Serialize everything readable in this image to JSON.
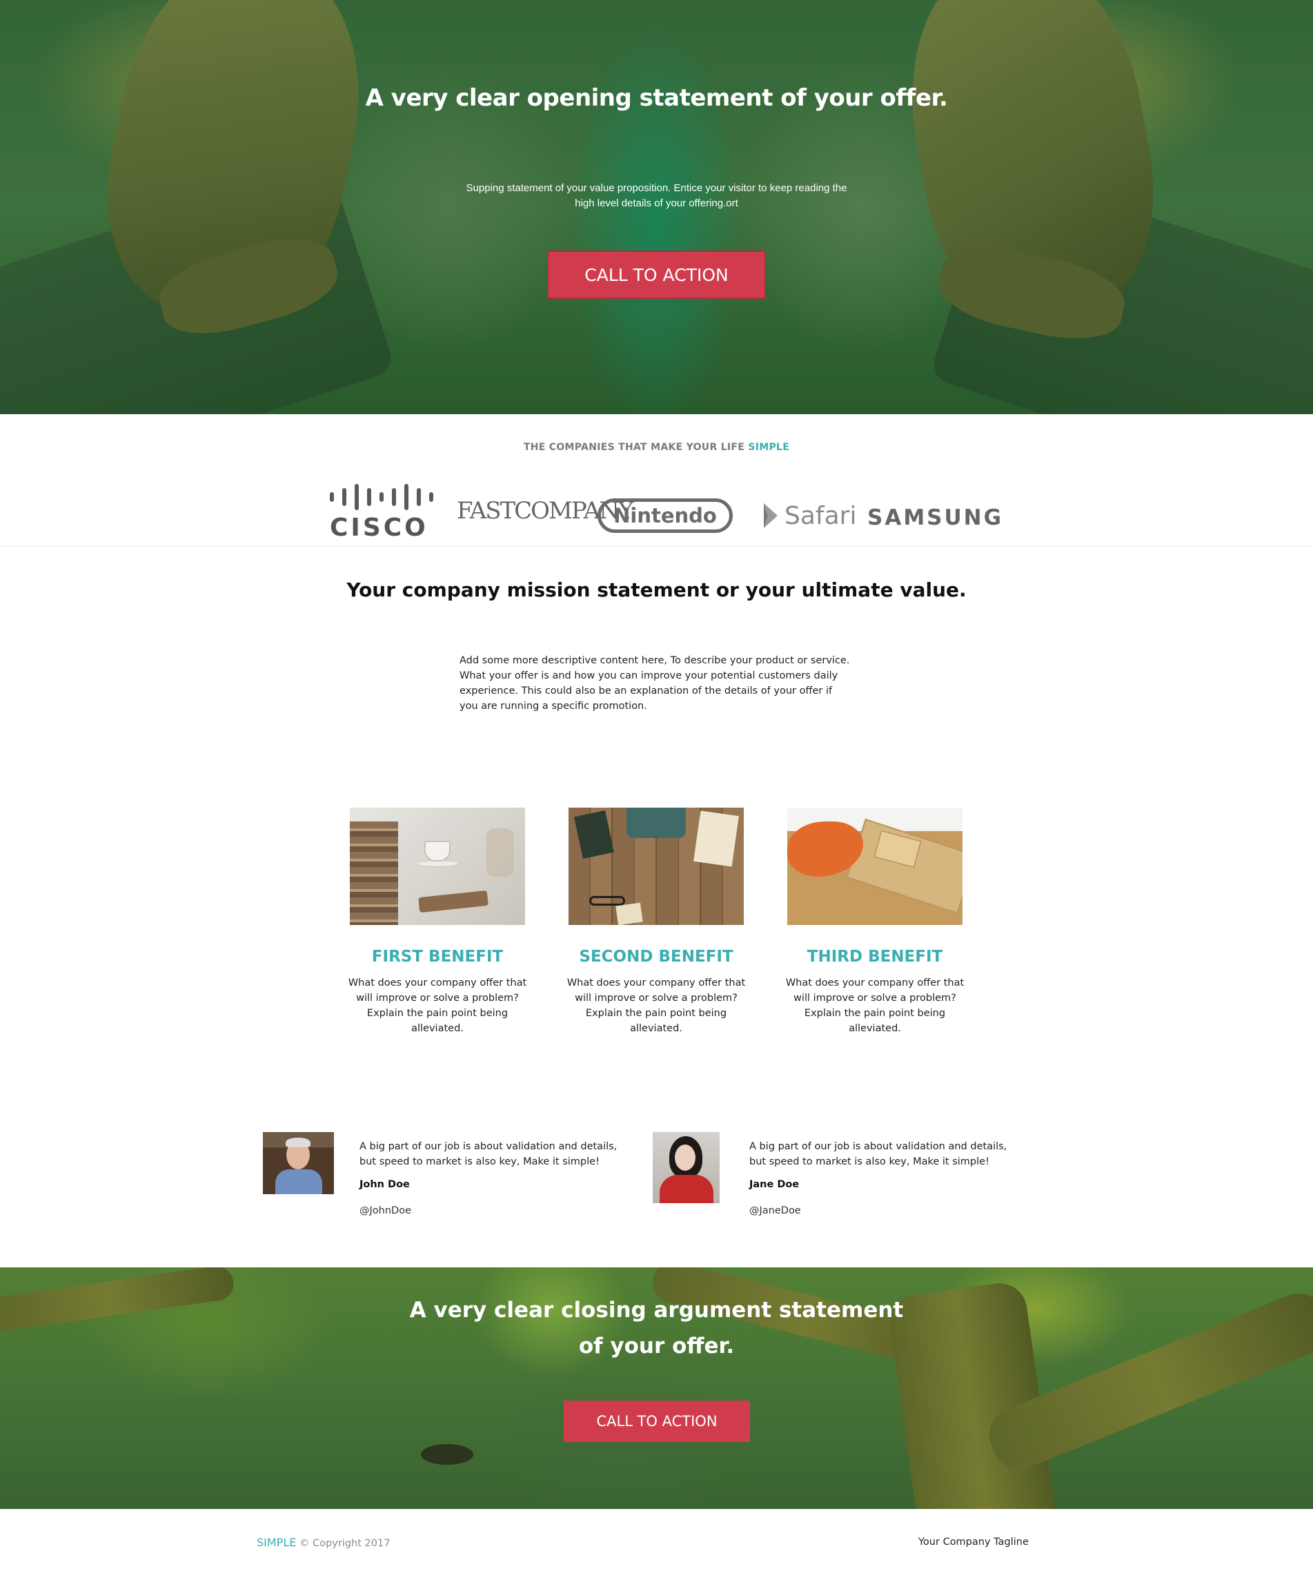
{
  "hero": {
    "title": "A very clear opening statement of your offer.",
    "subtitle": "Supping statement of your value proposition. Entice your visitor to keep reading the high level details of your offering.ort",
    "cta_label": "CALL TO ACTION"
  },
  "companies": {
    "heading_prefix": "THE COMPANIES THAT MAKE YOUR LIFE ",
    "heading_accent": "SIMPLE",
    "logos": {
      "cisco": "CISCO",
      "fast_company": "FASTCOMPANY",
      "nintendo": "Nintendo",
      "safari": "Safari",
      "samsung": "SAMSUNG"
    }
  },
  "mission": {
    "title": "Your company mission statement or your ultimate value.",
    "body": "Add some more descriptive content here, To describe your product or service. What your offer is and how you can improve your potential customers daily experience. This could also be an explanation of the details of your offer if you are running a specific promotion."
  },
  "benefits": [
    {
      "title": "FIRST BENEFIT",
      "text": "What does your company offer that will improve or solve a problem? Explain the pain point being alleviated."
    },
    {
      "title": "SECOND BENEFIT",
      "text": "What does your company offer that will improve or solve a problem? Explain the pain point being alleviated."
    },
    {
      "title": "THIRD BENEFIT",
      "text": "What does your company offer that will improve or solve a problem? Explain the pain point being alleviated."
    }
  ],
  "testimonials": [
    {
      "quote": "A big part of our job is about validation and details, but speed to market is also key, Make it simple!",
      "name": "John Doe",
      "handle": "@JohnDoe"
    },
    {
      "quote": "A big part of our job is about validation and details, but speed to market is also key, Make it simple!",
      "name": "Jane Doe",
      "handle": "@JaneDoe"
    }
  ],
  "closing": {
    "title": "A very clear closing argument statement of your offer.",
    "cta_label": "CALL TO ACTION"
  },
  "footer": {
    "brand": "SIMPLE",
    "copyright": " © Copyright 2017",
    "tagline": "Your Company Tagline"
  },
  "colors": {
    "accent": "#3aaeb0",
    "cta": "#d03c4d"
  }
}
